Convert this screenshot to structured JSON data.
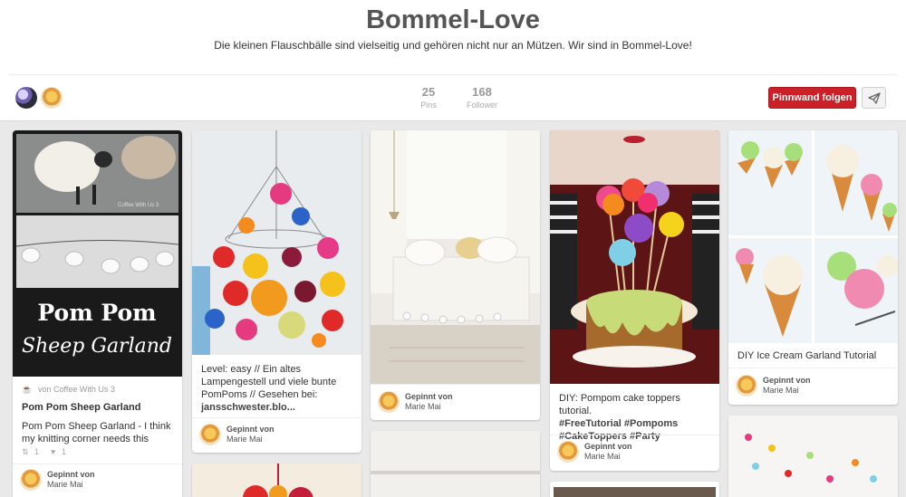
{
  "board": {
    "title": "Bommel-Love",
    "description": "Die kleinen Flauschbälle sind vielseitig und gehören nicht nur an Mützen. Wir sind in Bommel-Love!",
    "pins_count": "25",
    "pins_label": "Pins",
    "followers_count": "168",
    "followers_label": "Follower",
    "follow_label": "Pinnwand folgen"
  },
  "colors": {
    "accent": "#cb2027",
    "background": "#e9e9e9"
  },
  "icons": {
    "send": "paper-plane-icon",
    "source": "source-favicon-icon",
    "repin": "repin-icon",
    "like": "heart-icon"
  },
  "pins": [
    {
      "image_text_1": "Pom Pom",
      "image_text_2": "Sheep Garland",
      "image_credit": "Coffee With Us 3",
      "source": "von Coffee With Us 3",
      "title": "Pom Pom Sheep Garland",
      "description": "Pom Pom Sheep Garland - I think my knitting corner needs this",
      "repins": "1",
      "likes": "1",
      "pinner_label": "Gepinnt von",
      "pinner_name": "Marie Mai"
    },
    {
      "description_1": "Level: easy // Ein altes Lampengestell und viele bunte PomPoms // Gesehen bei:",
      "description_link": "jansschwester.blo...",
      "pinner_label": "Gepinnt von",
      "pinner_name": "Marie Mai"
    },
    {
      "pinner_label": "Gepinnt von",
      "pinner_name": "Marie Mai"
    },
    {
      "description_1": "DIY: Pompom cake toppers tutorial.",
      "description_tags": "#FreeTutorial #Pompoms #CakeToppers #Party",
      "pinner_label": "Gepinnt von",
      "pinner_name": "Marie Mai"
    },
    {
      "description": "DIY Ice Cream Garland Tutorial",
      "pinner_label": "Gepinnt von",
      "pinner_name": "Marie Mai"
    }
  ]
}
